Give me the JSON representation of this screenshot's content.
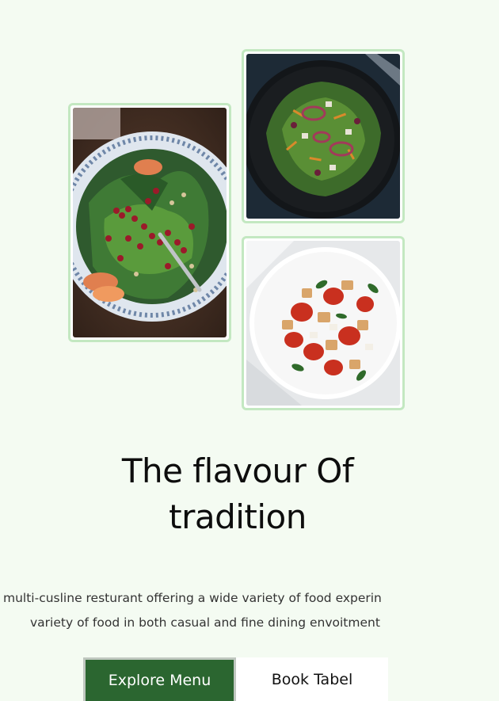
{
  "hero": {
    "title_line1": "The flavour Of",
    "title_line2": "tradition",
    "description_line1": "multi-cusline resturant offering a wide variety of food experin",
    "description_line2": "variety of food in both casual and fine dining envoitment"
  },
  "buttons": {
    "explore_label": "Explore Menu",
    "book_label": "Book Tabel"
  },
  "colors": {
    "background": "#f4fbf2",
    "frame_border": "#c3e8c1",
    "primary_button": "#2b6630",
    "secondary_button": "#ffffff"
  },
  "images": [
    {
      "name": "pomegranate-spinach-salad-photo"
    },
    {
      "name": "dark-plate-salad-photo"
    },
    {
      "name": "tomato-bread-salad-photo"
    }
  ]
}
